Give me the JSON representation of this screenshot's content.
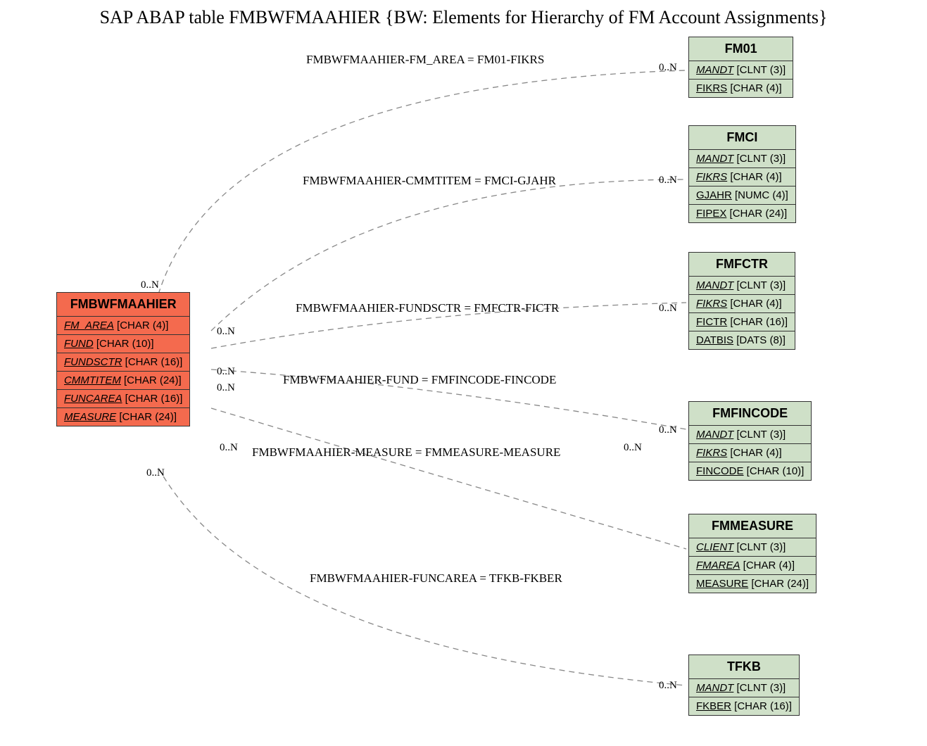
{
  "title": "SAP ABAP table FMBWFMAAHIER {BW: Elements for Hierarchy of FM Account Assignments}",
  "main": {
    "name": "FMBWFMAAHIER",
    "fields": [
      {
        "name": "FM_AREA",
        "type": "[CHAR (4)]"
      },
      {
        "name": "FUND",
        "type": "[CHAR (10)]"
      },
      {
        "name": "FUNDSCTR",
        "type": "[CHAR (16)]"
      },
      {
        "name": "CMMTITEM",
        "type": "[CHAR (24)]"
      },
      {
        "name": "FUNCAREA",
        "type": "[CHAR (16)]"
      },
      {
        "name": "MEASURE",
        "type": "[CHAR (24)]"
      }
    ]
  },
  "targets": [
    {
      "name": "FM01",
      "fields": [
        {
          "name": "MANDT",
          "type": "[CLNT (3)]",
          "fk": true
        },
        {
          "name": "FIKRS",
          "type": "[CHAR (4)]",
          "fk": false
        }
      ]
    },
    {
      "name": "FMCI",
      "fields": [
        {
          "name": "MANDT",
          "type": "[CLNT (3)]",
          "fk": true
        },
        {
          "name": "FIKRS",
          "type": "[CHAR (4)]",
          "fk": true
        },
        {
          "name": "GJAHR",
          "type": "[NUMC (4)]",
          "fk": false
        },
        {
          "name": "FIPEX",
          "type": "[CHAR (24)]",
          "fk": false
        }
      ]
    },
    {
      "name": "FMFCTR",
      "fields": [
        {
          "name": "MANDT",
          "type": "[CLNT (3)]",
          "fk": true
        },
        {
          "name": "FIKRS",
          "type": "[CHAR (4)]",
          "fk": true
        },
        {
          "name": "FICTR",
          "type": "[CHAR (16)]",
          "fk": false
        },
        {
          "name": "DATBIS",
          "type": "[DATS (8)]",
          "fk": false
        }
      ]
    },
    {
      "name": "FMFINCODE",
      "fields": [
        {
          "name": "MANDT",
          "type": "[CLNT (3)]",
          "fk": true
        },
        {
          "name": "FIKRS",
          "type": "[CHAR (4)]",
          "fk": true
        },
        {
          "name": "FINCODE",
          "type": "[CHAR (10)]",
          "fk": false
        }
      ]
    },
    {
      "name": "FMMEASURE",
      "fields": [
        {
          "name": "CLIENT",
          "type": "[CLNT (3)]",
          "fk": true
        },
        {
          "name": "FMAREA",
          "type": "[CHAR (4)]",
          "fk": true
        },
        {
          "name": "MEASURE",
          "type": "[CHAR (24)]",
          "fk": false
        }
      ]
    },
    {
      "name": "TFKB",
      "fields": [
        {
          "name": "MANDT",
          "type": "[CLNT (3)]",
          "fk": true
        },
        {
          "name": "FKBER",
          "type": "[CHAR (16)]",
          "fk": false
        }
      ]
    }
  ],
  "relations": [
    {
      "label": "FMBWFMAAHIER-FM_AREA = FM01-FIKRS",
      "leftCard": "0..N",
      "rightCard": "0..N"
    },
    {
      "label": "FMBWFMAAHIER-CMMTITEM = FMCI-GJAHR",
      "leftCard": "0..N",
      "rightCard": "0..N"
    },
    {
      "label": "FMBWFMAAHIER-FUNDSCTR = FMFCTR-FICTR",
      "leftCard": "0..N",
      "rightCard": "0..N"
    },
    {
      "label": "FMBWFMAAHIER-FUND = FMFINCODE-FINCODE",
      "leftCard": "0..N",
      "rightCard": "0..N"
    },
    {
      "label": "FMBWFMAAHIER-MEASURE = FMMEASURE-MEASURE",
      "leftCard": "0..N",
      "rightCard": "0..N"
    },
    {
      "label": "FMBWFMAAHIER-FUNCAREA = TFKB-FKBER",
      "leftCard": "0..N",
      "rightCard": "0..N"
    }
  ]
}
